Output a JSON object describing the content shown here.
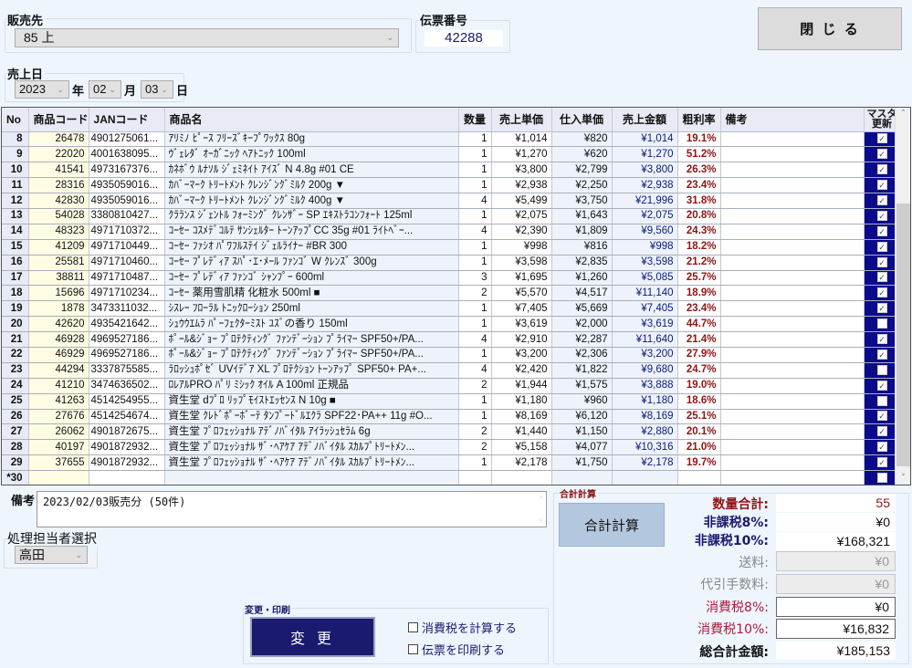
{
  "header": {
    "customer_label": "販売先",
    "customer_value": "85 上",
    "slip_label": "伝票番号",
    "slip_value": "42288",
    "close_button": "閉 じ る",
    "date_label": "売上日",
    "year": "2023",
    "year_unit": "年",
    "month": "02",
    "month_unit": "月",
    "day": "03",
    "day_unit": "日"
  },
  "grid": {
    "columns": [
      "No",
      "商品コード",
      "JANコード",
      "商品名",
      "数量",
      "売上単価",
      "仕入単価",
      "売上金額",
      "粗利率",
      "備考",
      "マスタ\n更新"
    ],
    "master_header_line1": "マスタ",
    "master_header_line2": "更新",
    "rows": [
      {
        "no": "8",
        "code": "26478",
        "jan": "4901275061...",
        "name": "ｱﾘﾐﾉ ﾋﾟｰｽ ﾌﾘｰｽﾞｷｰﾌﾟﾜｯｸｽ 80g",
        "qty": "1",
        "price": "¥1,014",
        "cost": "¥820",
        "amount": "¥1,014",
        "rate": "19.1%",
        "note": "",
        "master": true
      },
      {
        "no": "9",
        "code": "22020",
        "jan": "4001638095...",
        "name": "ｳﾞｪﾚﾀﾞ ｵｰｶﾞﾆｯｸ ﾍｱﾄﾆｯｸ 100ml",
        "qty": "1",
        "price": "¥1,270",
        "cost": "¥620",
        "amount": "¥1,270",
        "rate": "51.2%",
        "note": "",
        "master": true
      },
      {
        "no": "10",
        "code": "41541",
        "jan": "4973167376...",
        "name": "ｶﾈﾎﾞｳ ﾙﾅｿﾙ ｼﾞｪﾐﾈｲﾄ ｱｲｽﾞ N 4.8g #01 CE",
        "qty": "1",
        "price": "¥3,800",
        "cost": "¥2,799",
        "amount": "¥3,800",
        "rate": "26.3%",
        "note": "",
        "master": true
      },
      {
        "no": "11",
        "code": "28316",
        "jan": "4935059016...",
        "name": "ｶﾊﾞｰﾏｰｸ ﾄﾘｰﾄﾒﾝﾄ ｸﾚﾝｼﾞﾝｸﾞﾐﾙｸ 200g ▼",
        "qty": "1",
        "price": "¥2,938",
        "cost": "¥2,250",
        "amount": "¥2,938",
        "rate": "23.4%",
        "note": "",
        "master": true
      },
      {
        "no": "12",
        "code": "42830",
        "jan": "4935059016...",
        "name": "ｶﾊﾞｰﾏｰｸ ﾄﾘｰﾄﾒﾝﾄ ｸﾚﾝｼﾞﾝｸﾞﾐﾙｸ 400g ▼",
        "qty": "4",
        "price": "¥5,499",
        "cost": "¥3,750",
        "amount": "¥21,996",
        "rate": "31.8%",
        "note": "",
        "master": true
      },
      {
        "no": "13",
        "code": "54028",
        "jan": "3380810427...",
        "name": "ｸﾗﾗﾝｽ ｼﾞｪﾝﾄﾙ ﾌｫｰﾐﾝｸﾞ ｸﾚﾝｻﾞｰ SP ｴｷｽﾄﾗｺﾝﾌｫｰﾄ 125ml",
        "qty": "1",
        "price": "¥2,075",
        "cost": "¥1,643",
        "amount": "¥2,075",
        "rate": "20.8%",
        "note": "",
        "master": true
      },
      {
        "no": "14",
        "code": "48323",
        "jan": "4971710372...",
        "name": "ｺｰｾｰ ｺｽﾒﾃﾞｺﾙﾃ ｻﾝｼｪﾙﾀｰ ﾄｰﾝｱｯﾌﾟCC 35g #01 ﾗｲﾄﾍﾞｰ...",
        "qty": "4",
        "price": "¥2,390",
        "cost": "¥1,809",
        "amount": "¥9,560",
        "rate": "24.3%",
        "note": "",
        "master": true
      },
      {
        "no": "15",
        "code": "41209",
        "jan": "4971710449...",
        "name": "ｺｰｾｰ ﾌｧｼｵ ﾊﾟﾜﾌﾙｽﾃｲ ｼﾞｪﾙﾗｲﾅｰ #BR 300",
        "qty": "1",
        "price": "¥998",
        "cost": "¥816",
        "amount": "¥998",
        "rate": "18.2%",
        "note": "",
        "master": true
      },
      {
        "no": "16",
        "code": "25581",
        "jan": "4971710460...",
        "name": "ｺｰｾｰ ﾌﾟﾚﾃﾞｨｱ ｽﾊﾟ･ｴ･ﾒｰﾙ ﾌｧﾝｺﾞ W ｸﾚﾝｽﾞ 300g",
        "qty": "1",
        "price": "¥3,598",
        "cost": "¥2,835",
        "amount": "¥3,598",
        "rate": "21.2%",
        "note": "",
        "master": true
      },
      {
        "no": "17",
        "code": "38811",
        "jan": "4971710487...",
        "name": "ｺｰｾｰ ﾌﾟﾚﾃﾞｨｱ ﾌｧﾝｺﾞ ｼｬﾝﾌﾟｰ 600ml",
        "qty": "3",
        "price": "¥1,695",
        "cost": "¥1,260",
        "amount": "¥5,085",
        "rate": "25.7%",
        "note": "",
        "master": true
      },
      {
        "no": "18",
        "code": "15696",
        "jan": "4971710234...",
        "name": "ｺｰｾｰ 薬用雪肌精 化粧水 500ml ■",
        "qty": "2",
        "price": "¥5,570",
        "cost": "¥4,517",
        "amount": "¥11,140",
        "rate": "18.9%",
        "note": "",
        "master": true
      },
      {
        "no": "19",
        "code": "1878",
        "jan": "3473311032...",
        "name": "ｼｽﾚｰ ﾌﾛｰﾗﾙ ﾄﾆｯｸﾛｰｼｮﾝ 250ml",
        "qty": "1",
        "price": "¥7,405",
        "cost": "¥5,669",
        "amount": "¥7,405",
        "rate": "23.4%",
        "note": "",
        "master": true
      },
      {
        "no": "20",
        "code": "42620",
        "jan": "4935421642...",
        "name": "ｼｭｳｳｴﾑﾗ ﾊﾟｰﾌｪｸﾀｰﾐｽﾄ ﾕｽﾞの香り 150ml",
        "qty": "1",
        "price": "¥3,619",
        "cost": "¥2,000",
        "amount": "¥3,619",
        "rate": "44.7%",
        "note": "",
        "master": false
      },
      {
        "no": "21",
        "code": "46928",
        "jan": "4969527186...",
        "name": "ﾎﾟｰﾙ&ｼﾞｮｰ ﾌﾟﾛﾃｸﾃｨﾝｸﾞ ﾌｧﾝﾃﾞｰｼｮﾝ ﾌﾟﾗｲﾏｰ SPF50+/PA...",
        "qty": "4",
        "price": "¥2,910",
        "cost": "¥2,287",
        "amount": "¥11,640",
        "rate": "21.4%",
        "note": "",
        "master": true
      },
      {
        "no": "22",
        "code": "46929",
        "jan": "4969527186...",
        "name": "ﾎﾟｰﾙ&ｼﾞｮｰ ﾌﾟﾛﾃｸﾃｨﾝｸﾞ ﾌｧﾝﾃﾞｰｼｮﾝ ﾌﾟﾗｲﾏｰ SPF50+/PA...",
        "qty": "1",
        "price": "¥3,200",
        "cost": "¥2,306",
        "amount": "¥3,200",
        "rate": "27.9%",
        "note": "",
        "master": true
      },
      {
        "no": "23",
        "code": "44294",
        "jan": "3337875585...",
        "name": "ﾗﾛｯｼｭﾎﾟｾﾞ UVｲﾃﾞｱ XL ﾌﾟﾛﾃｸｼｮﾝ ﾄｰﾝｱｯﾌﾟ SPF50+ PA+...",
        "qty": "4",
        "price": "¥2,420",
        "cost": "¥1,822",
        "amount": "¥9,680",
        "rate": "24.7%",
        "note": "",
        "master": false
      },
      {
        "no": "24",
        "code": "41210",
        "jan": "3474636502...",
        "name": "ﾛﾚｱﾙPRO ﾊﾟﾘ ﾐｼｯｸ ｵｲﾙ A 100ml 正規品",
        "qty": "2",
        "price": "¥1,944",
        "cost": "¥1,575",
        "amount": "¥3,888",
        "rate": "19.0%",
        "note": "",
        "master": true
      },
      {
        "no": "25",
        "code": "41263",
        "jan": "4514254955...",
        "name": "資生堂 dﾌﾟﾛ ﾘｯﾌﾟﾓｲｽﾄｴｯｾﾝｽ N 10g ■",
        "qty": "1",
        "price": "¥1,180",
        "cost": "¥960",
        "amount": "¥1,180",
        "rate": "18.6%",
        "note": "",
        "master": false
      },
      {
        "no": "26",
        "code": "27676",
        "jan": "4514254674...",
        "name": "資生堂 ｸﾚﾄﾞﾎﾟｰﾎﾞｰﾃ ﾀﾝﾌﾟｰﾄﾞﾙｴｸﾗ SPF22･PA++ 11g #O...",
        "qty": "1",
        "price": "¥8,169",
        "cost": "¥6,120",
        "amount": "¥8,169",
        "rate": "25.1%",
        "note": "",
        "master": true
      },
      {
        "no": "27",
        "code": "26062",
        "jan": "4901872675...",
        "name": "資生堂 ﾌﾟﾛﾌｪｯｼｮﾅﾙ ｱﾃﾞﾉﾊﾞｲﾀﾙ ｱｲﾗｯｼｭｾﾗﾑ 6g",
        "qty": "2",
        "price": "¥1,440",
        "cost": "¥1,150",
        "amount": "¥2,880",
        "rate": "20.1%",
        "note": "",
        "master": true
      },
      {
        "no": "28",
        "code": "40197",
        "jan": "4901872932...",
        "name": "資生堂 ﾌﾟﾛﾌｪｯｼｮﾅﾙ ｻﾞ･ﾍｱｹｱ ｱﾃﾞﾉﾊﾞｲﾀﾙ ｽｶﾙﾌﾟﾄﾘｰﾄﾒﾝ...",
        "qty": "2",
        "price": "¥5,158",
        "cost": "¥4,077",
        "amount": "¥10,316",
        "rate": "21.0%",
        "note": "",
        "master": true
      },
      {
        "no": "29",
        "code": "37655",
        "jan": "4901872932...",
        "name": "資生堂 ﾌﾟﾛﾌｪｯｼｮﾅﾙ ｻﾞ･ﾍｱｹｱ ｱﾃﾞﾉﾊﾞｲﾀﾙ ｽｶﾙﾌﾟﾄﾘｰﾄﾒﾝ...",
        "qty": "1",
        "price": "¥2,178",
        "cost": "¥1,750",
        "amount": "¥2,178",
        "rate": "19.7%",
        "note": "",
        "master": true
      },
      {
        "no": "*30",
        "code": "",
        "jan": "",
        "name": "",
        "qty": "",
        "price": "",
        "cost": "",
        "amount": "",
        "rate": "",
        "note": "",
        "master": false
      }
    ]
  },
  "footer": {
    "memo_label": "備考",
    "memo_value": "2023/02/03販売分 (50件)",
    "staff_label": "処理担当者選択",
    "staff_value": "高田",
    "change_group_label": "変更・印刷",
    "change_button": "変 更",
    "calc_tax_label": "消費税を計算する",
    "print_slip_label": "伝票を印刷する",
    "calc_tax_checked": false,
    "print_slip_checked": false,
    "total_group_label": "合計計算",
    "total_button": "合計計算"
  },
  "summary": {
    "qty_total_label": "数量合計:",
    "qty_total": "55",
    "nontax8_label": "非課税8%:",
    "nontax8": "¥0",
    "nontax10_label": "非課税10%:",
    "nontax10": "¥168,321",
    "shipping_label": "送料:",
    "shipping": "¥0",
    "cod_fee_label": "代引手数料:",
    "cod_fee": "¥0",
    "tax8_label": "消費税8%:",
    "tax8": "¥0",
    "tax10_label": "消費税10%:",
    "tax10": "¥16,832",
    "grand_total_label": "総合計金額:",
    "grand_total": "¥185,153"
  },
  "colors": {
    "background": "#eef5fd",
    "navy_button": "#1a1a6e",
    "master_cell": "#0a0a8a",
    "rate_text": "#8f1414",
    "amount_text": "#0b1a80",
    "total_button": "#b3c7df"
  }
}
